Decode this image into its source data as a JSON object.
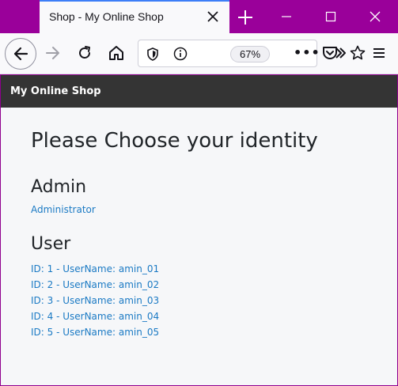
{
  "browser": {
    "tab_title": "Shop - My Online Shop",
    "zoom_level": "67%",
    "more_label": "•••"
  },
  "page": {
    "brand": "My Online Shop",
    "heading": "Please Choose your identity",
    "admin_section": {
      "title": "Admin",
      "link": "Administrator"
    },
    "user_section": {
      "title": "User",
      "users": [
        "ID: 1 - UserName: amin_01",
        "ID: 2 - UserName: amin_02",
        "ID: 3 - UserName: amin_03",
        "ID: 4 - UserName: amin_04",
        "ID: 5 - UserName: amin_05"
      ]
    }
  },
  "colors": {
    "window_frame": "#9a009a",
    "header_bg": "#343434",
    "link": "#1b7ac4",
    "tab_accent": "#3d7ef7"
  },
  "icons": [
    "close-icon",
    "plus-icon",
    "minimize-icon",
    "maximize-icon",
    "window-close-icon",
    "back-arrow-icon",
    "forward-arrow-icon",
    "reload-icon",
    "home-icon",
    "shield-icon",
    "info-icon",
    "pocket-icon",
    "extensions-chevron-icon",
    "star-icon",
    "hamburger-menu-icon"
  ]
}
